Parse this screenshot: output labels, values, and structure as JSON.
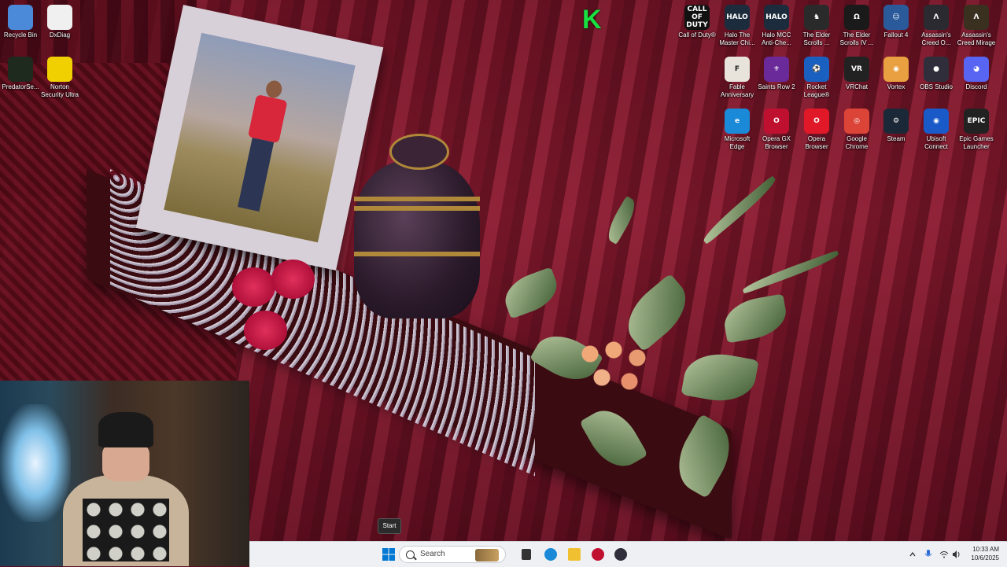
{
  "desktop": {
    "left_icons": [
      {
        "label": "Recycle Bin",
        "icon": "recycle-bin-icon",
        "color": "#4a8ad8"
      },
      {
        "label": "DxDiag",
        "icon": "document-icon",
        "color": "#f0f0f0"
      },
      {
        "label": "PredatorSe...",
        "icon": "predator-icon",
        "color": "#1e2a1e"
      },
      {
        "label": "Norton Security Ultra",
        "icon": "norton-icon",
        "color": "#f0d000"
      }
    ],
    "right_icons_row1": [
      {
        "label": "Call of Duty®",
        "glyph": "CALL OF DUTY",
        "icon": "call-of-duty-icon",
        "color": "#111111"
      },
      {
        "label": "Halo The Master Chi...",
        "glyph": "HALO",
        "icon": "halo-mcc-icon",
        "color": "#1c2c3c"
      },
      {
        "label": "Halo MCC Anti-Che...",
        "glyph": "HALO",
        "icon": "halo-anticheat-icon",
        "color": "#1c2c3c"
      },
      {
        "label": "The Elder Scrolls ...",
        "glyph": "♞",
        "icon": "elder-scrolls-icon",
        "color": "#2a2a2a"
      },
      {
        "label": "The Elder Scrolls IV ...",
        "glyph": "Ω",
        "icon": "oblivion-icon",
        "color": "#1a1a1a"
      },
      {
        "label": "Fallout 4",
        "glyph": "☺",
        "icon": "fallout-icon",
        "color": "#2a5a9a"
      },
      {
        "label": "Assassin's Creed O...",
        "glyph": "Λ",
        "icon": "ac-odyssey-icon",
        "color": "#2a2a30"
      },
      {
        "label": "Assassin's Creed Mirage",
        "glyph": "Λ",
        "icon": "ac-mirage-icon",
        "color": "#3a3020"
      }
    ],
    "right_icons_row2": [
      {
        "label": "Fable Anniversary",
        "glyph": "F",
        "icon": "fable-icon",
        "color": "#e8e4dc"
      },
      {
        "label": "Saints Row 2",
        "glyph": "⚜",
        "icon": "saints-row-icon",
        "color": "#6a2a9a"
      },
      {
        "label": "Rocket League®",
        "glyph": "⚽",
        "icon": "rocket-league-icon",
        "color": "#1a60c0"
      },
      {
        "label": "VRChat",
        "glyph": "VR",
        "icon": "vrchat-icon",
        "color": "#222222"
      },
      {
        "label": "Vortex",
        "glyph": "◉",
        "icon": "vortex-icon",
        "color": "#e8a040"
      },
      {
        "label": "OBS Studio",
        "glyph": "●",
        "icon": "obs-icon",
        "color": "#302e3a"
      },
      {
        "label": "Discord",
        "glyph": "◕",
        "icon": "discord-icon",
        "color": "#5865f2"
      }
    ],
    "right_icons_row3": [
      {
        "label": "Microsoft Edge",
        "glyph": "e",
        "icon": "edge-icon",
        "color": "#1a8ad8"
      },
      {
        "label": "Opera GX Browser",
        "glyph": "O",
        "icon": "opera-gx-icon",
        "color": "#c01030"
      },
      {
        "label": "Opera Browser",
        "glyph": "O",
        "icon": "opera-icon",
        "color": "#e01828"
      },
      {
        "label": "Google Chrome",
        "glyph": "◎",
        "icon": "chrome-icon",
        "color": "#db4437"
      },
      {
        "label": "Steam",
        "glyph": "⚙",
        "icon": "steam-icon",
        "color": "#1b2838"
      },
      {
        "label": "Ubisoft Connect",
        "glyph": "◉",
        "icon": "ubisoft-icon",
        "color": "#1a5ac8"
      },
      {
        "label": "Epic Games Launcher",
        "glyph": "EPIC",
        "icon": "epic-games-icon",
        "color": "#222222"
      }
    ]
  },
  "overlay_badge": "K",
  "start_tooltip": "Start",
  "taskbar": {
    "search_placeholder": "Search",
    "pinned": [
      {
        "icon": "task-view-icon",
        "color": "#333333"
      },
      {
        "icon": "edge-icon",
        "color": "#1a8ad8"
      },
      {
        "icon": "file-explorer-icon",
        "color": "#f0c030"
      },
      {
        "icon": "opera-gx-icon",
        "color": "#c01030"
      },
      {
        "icon": "obs-icon",
        "color": "#302e3a"
      }
    ],
    "clock_time": "10:33 AM",
    "clock_date": "10/6/2025"
  },
  "colors": {
    "accent": "#0067c0",
    "taskbar_bg": "#eef0f4"
  }
}
